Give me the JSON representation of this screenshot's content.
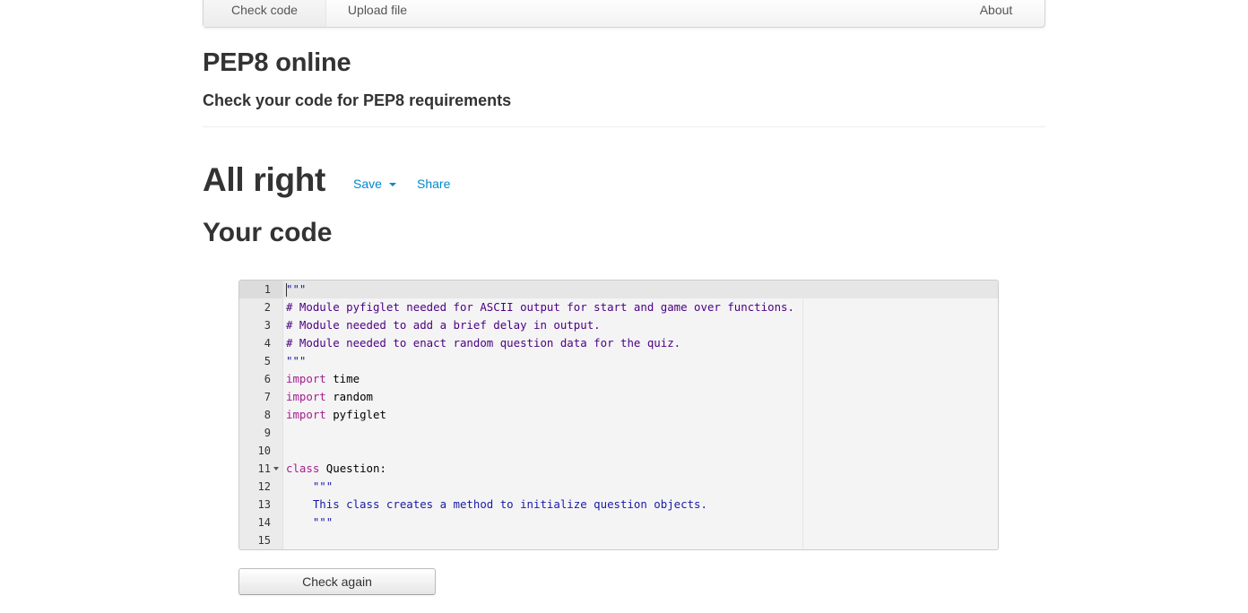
{
  "nav": {
    "check_code": "Check code",
    "upload_file": "Upload file",
    "about": "About"
  },
  "header": {
    "title": "PEP8 online",
    "subtitle": "Check your code for PEP8 requirements"
  },
  "result": {
    "status": "All right",
    "save_label": "Save",
    "share_label": "Share",
    "code_heading": "Your code"
  },
  "editor": {
    "line_numbers": [
      "1",
      "2",
      "3",
      "4",
      "5",
      "6",
      "7",
      "8",
      "9",
      "10",
      "11",
      "12",
      "13",
      "14",
      "15"
    ],
    "lines": {
      "l1": "\"\"\"",
      "l2": "# Module pyfiglet needed for ASCII output for start and game over functions.",
      "l3": "# Module needed to add a brief delay in output.",
      "l4": "# Module needed to enact random question data for the quiz.",
      "l5": "\"\"\"",
      "l6_kw": "import",
      "l6_name": " time",
      "l7_kw": "import",
      "l7_name": " random",
      "l8_kw": "import",
      "l8_name": " pyfiglet",
      "l11_kw": "class",
      "l11_name": " Question:",
      "l12": "    \"\"\"",
      "l13": "    This class creates a method to initialize question objects.",
      "l14": "    \"\"\""
    }
  },
  "actions": {
    "check_again": "Check again"
  },
  "colors": {
    "link": "#0088cc",
    "keyword": "#a31e8f",
    "comment": "#4b0082",
    "string": "#1a1aa6"
  }
}
